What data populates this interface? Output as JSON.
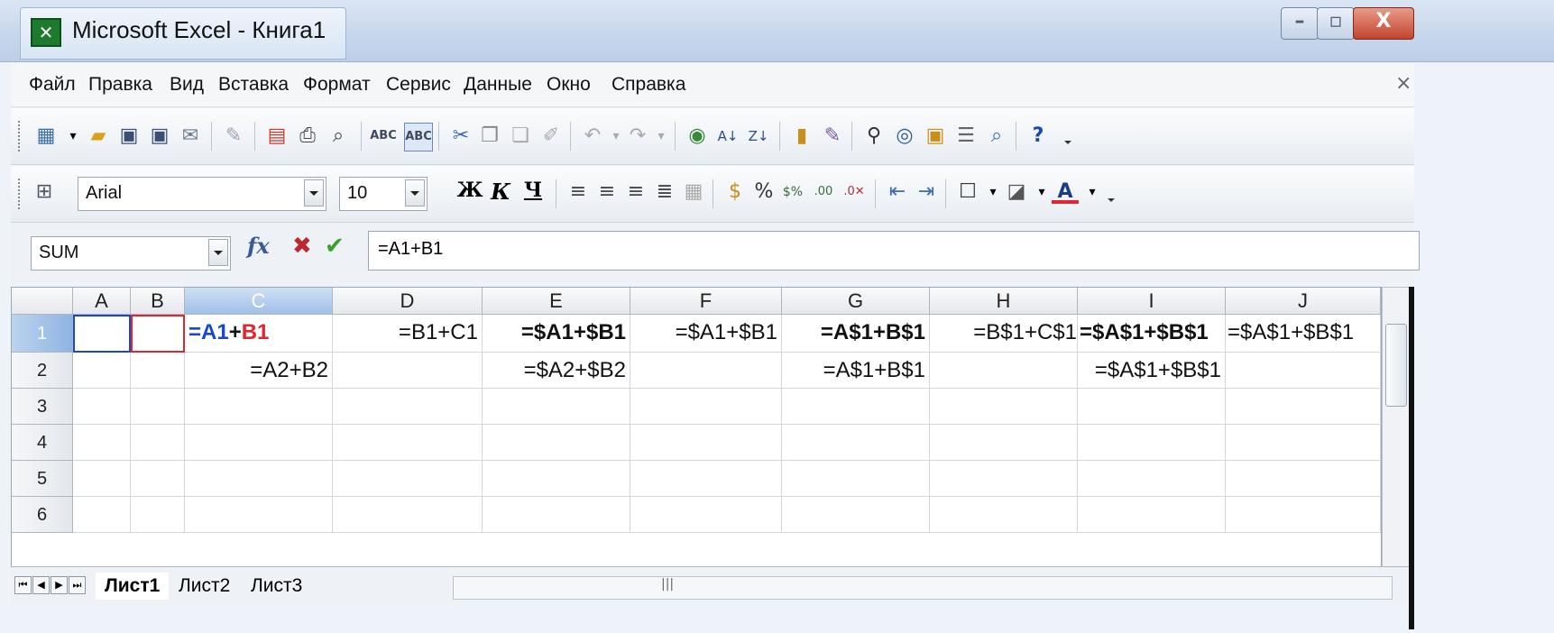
{
  "window": {
    "title": "Microsoft Excel - Книга1"
  },
  "menu": [
    "Файл",
    "Правка",
    "Вид",
    "Вставка",
    "Формат",
    "Сервис",
    "Данные",
    "Окно",
    "Справка"
  ],
  "toolbar": {
    "font_name": "Arial",
    "font_size": "10",
    "bold_label": "Ж",
    "italic_label": "К",
    "underline_label": "Ч"
  },
  "formula_bar": {
    "name_box": "SUM",
    "fx_label": "fx",
    "formula": "=A1+B1"
  },
  "grid": {
    "columns": [
      "A",
      "B",
      "C",
      "D",
      "E",
      "F",
      "G",
      "H",
      "I",
      "J"
    ],
    "rows": [
      "1",
      "2",
      "3",
      "4",
      "5",
      "6"
    ],
    "cells": {
      "C1_a": "=A1",
      "C1_plus": "+",
      "C1_b": "B1",
      "D1": "=B1+C1",
      "E1": "=$A1+$B1",
      "F1": "=$A1+$B1",
      "G1": "=A$1+B$1",
      "H1": "=B$1+C$1",
      "I1": "=$A$1+$B$1",
      "J1": "=$A$1+$B$1",
      "C2": "=A2+B2",
      "E2": "=$A2+$B2",
      "G2": "=A$1+B$1",
      "I2": "=$A$1+$B$1"
    }
  },
  "sheets": [
    "Лист1",
    "Лист2",
    "Лист3"
  ],
  "colors": {
    "ref_blue": "#1a49c8",
    "ref_red": "#e0262f"
  }
}
